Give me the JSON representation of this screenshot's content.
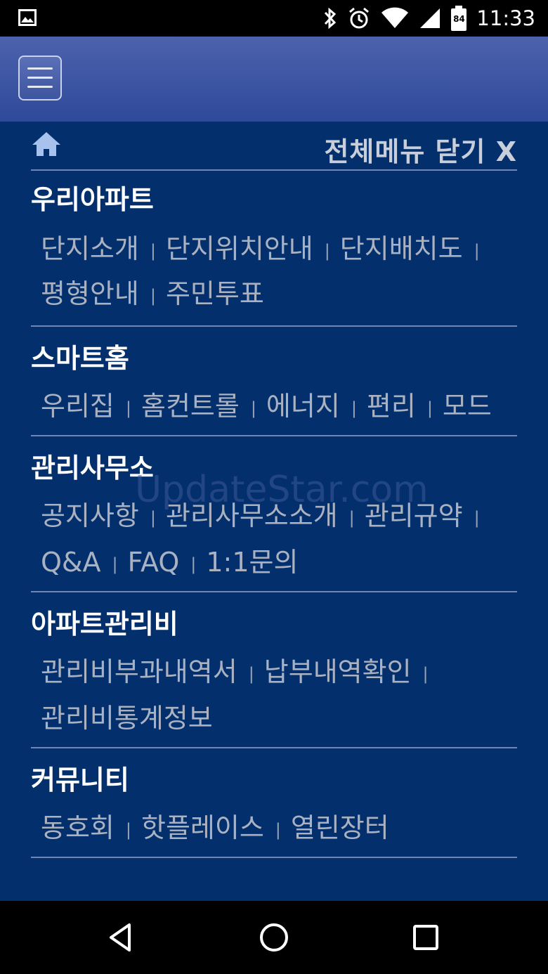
{
  "status_bar": {
    "time": "11:33",
    "battery_level": "84",
    "icons": [
      "image-icon",
      "bluetooth-icon",
      "alarm-icon",
      "wifi-icon",
      "signal-icon",
      "battery-icon"
    ]
  },
  "header": {
    "menu_icon": "hamburger-menu-icon"
  },
  "panel": {
    "home_icon": "home-icon",
    "close_label": "전체메뉴 닫기 X"
  },
  "sections": [
    {
      "title": "우리아파트",
      "rows": [
        [
          "단지소개",
          "단지위치안내",
          "단지배치도"
        ],
        [
          "평형안내",
          "주민투표"
        ]
      ]
    },
    {
      "title": "스마트홈",
      "rows": [
        [
          "우리집",
          "홈컨트롤",
          "에너지",
          "편리",
          "모드"
        ]
      ]
    },
    {
      "title": "관리사무소",
      "rows": [
        [
          "공지사항",
          "관리사무소소개",
          "관리규약"
        ],
        [
          "Q&A",
          "FAQ",
          "1:1문의"
        ]
      ]
    },
    {
      "title": "아파트관리비",
      "rows": [
        [
          "관리비부과내역서",
          "납부내역확인"
        ],
        [
          "관리비통계정보"
        ]
      ]
    },
    {
      "title": "커뮤니티",
      "rows": [
        [
          "동호회",
          "핫플레이스",
          "열린장터"
        ]
      ]
    }
  ],
  "watermark": "UpdateStar.com",
  "nav_bar": {
    "buttons": [
      "back-icon",
      "home-circle-icon",
      "recents-icon"
    ]
  },
  "colors": {
    "panel_bg": "#03306d",
    "header_bg": "#3e559f",
    "title_text": "#ffffff",
    "link_text": "#aab2c2",
    "divider": "#6f86b4"
  }
}
